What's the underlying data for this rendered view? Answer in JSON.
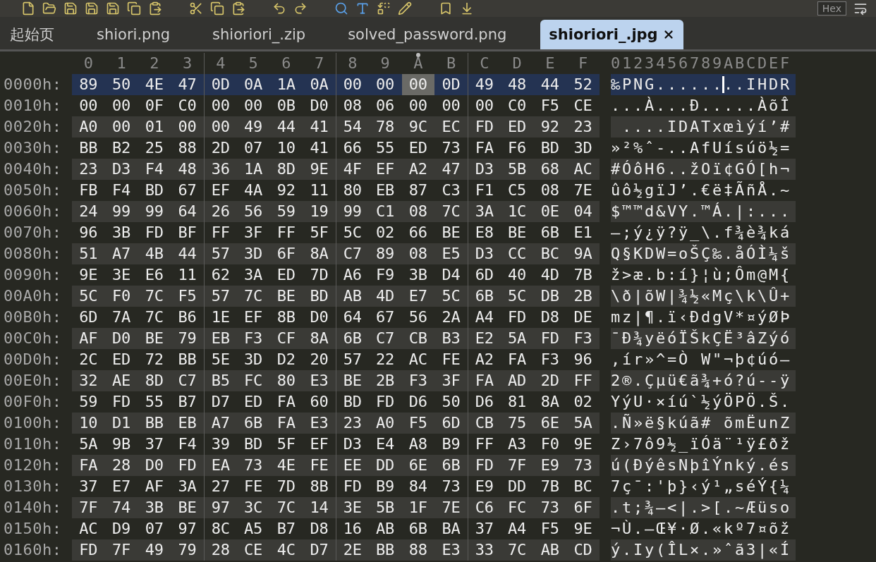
{
  "toolbar": {
    "label": "Hex"
  },
  "tabs": [
    {
      "label": "起始页",
      "selected": false
    },
    {
      "label": "shiori.png",
      "selected": false
    },
    {
      "label": "shioriori_.zip",
      "selected": false
    },
    {
      "label": "solved_password.png",
      "selected": false
    },
    {
      "label": "shioriori_.jpg",
      "selected": true
    }
  ],
  "hex_view": {
    "columns": [
      {
        "label": "0",
        "selected": false
      },
      {
        "label": "1",
        "selected": false
      },
      {
        "label": "2",
        "selected": false
      },
      {
        "label": "3",
        "selected": false
      },
      {
        "label": "4",
        "selected": false
      },
      {
        "label": "5",
        "selected": false
      },
      {
        "label": "6",
        "selected": false
      },
      {
        "label": "7",
        "selected": false
      },
      {
        "label": "8",
        "selected": false
      },
      {
        "label": "9",
        "selected": false
      },
      {
        "label": "A",
        "selected": true
      },
      {
        "label": "B",
        "selected": false
      },
      {
        "label": "C",
        "selected": false
      },
      {
        "label": "D",
        "selected": false
      },
      {
        "label": "E",
        "selected": false
      },
      {
        "label": "F",
        "selected": false
      }
    ],
    "ascii_header": "0123456789ABCDEF",
    "rows": [
      {
        "address": "0000h:",
        "selected": true,
        "bytes": [
          "89",
          "50",
          "4E",
          "47",
          "0D",
          "0A",
          "1A",
          "0A",
          "00",
          "00",
          "00",
          "0D",
          "49",
          "48",
          "44",
          "52"
        ],
        "ascii": "‰PNG........IHDR"
      },
      {
        "address": "0010h:",
        "selected": false,
        "bytes": [
          "00",
          "00",
          "0F",
          "C0",
          "00",
          "00",
          "0B",
          "D0",
          "08",
          "06",
          "00",
          "00",
          "00",
          "C0",
          "F5",
          "CE"
        ],
        "ascii": "...À...Ð.....ÀõÎ"
      },
      {
        "address": "0020h:",
        "selected": false,
        "bytes": [
          "A0",
          "00",
          "01",
          "00",
          "00",
          "49",
          "44",
          "41",
          "54",
          "78",
          "9C",
          "EC",
          "FD",
          "ED",
          "92",
          "23"
        ],
        "ascii": " ....IDATxœìýí’#"
      },
      {
        "address": "0030h:",
        "selected": false,
        "bytes": [
          "BB",
          "B2",
          "25",
          "88",
          "2D",
          "07",
          "10",
          "41",
          "66",
          "55",
          "ED",
          "73",
          "FA",
          "F6",
          "BD",
          "3D"
        ],
        "ascii": "»²%ˆ-..AfUísúö½="
      },
      {
        "address": "0040h:",
        "selected": false,
        "bytes": [
          "23",
          "D3",
          "F4",
          "48",
          "36",
          "1A",
          "8D",
          "9E",
          "4F",
          "EF",
          "A2",
          "47",
          "D3",
          "5B",
          "68",
          "AC"
        ],
        "ascii": "#ÓôH6..žOï¢GÓ[h¬"
      },
      {
        "address": "0050h:",
        "selected": false,
        "bytes": [
          "FB",
          "F4",
          "BD",
          "67",
          "EF",
          "4A",
          "92",
          "11",
          "80",
          "EB",
          "87",
          "C3",
          "F1",
          "C5",
          "08",
          "7E"
        ],
        "ascii": "ûô½gïJ’.€ë‡ÃñÅ.~"
      },
      {
        "address": "0060h:",
        "selected": false,
        "bytes": [
          "24",
          "99",
          "99",
          "64",
          "26",
          "56",
          "59",
          "19",
          "99",
          "C1",
          "08",
          "7C",
          "3A",
          "1C",
          "0E",
          "04"
        ],
        "ascii": "$™™d&VY.™Á.|:..."
      },
      {
        "address": "0070h:",
        "selected": false,
        "bytes": [
          "96",
          "3B",
          "FD",
          "BF",
          "FF",
          "3F",
          "FF",
          "5F",
          "5C",
          "02",
          "66",
          "BE",
          "E8",
          "BE",
          "6B",
          "E1"
        ],
        "ascii": "–;ý¿ÿ?ÿ_\\.f¾è¾ká"
      },
      {
        "address": "0080h:",
        "selected": false,
        "bytes": [
          "51",
          "A7",
          "4B",
          "44",
          "57",
          "3D",
          "6F",
          "8A",
          "C7",
          "89",
          "08",
          "E5",
          "D3",
          "CC",
          "BC",
          "9A"
        ],
        "ascii": "Q§KDW=oŠÇ‰.åÓÌ¼š"
      },
      {
        "address": "0090h:",
        "selected": false,
        "bytes": [
          "9E",
          "3E",
          "E6",
          "11",
          "62",
          "3A",
          "ED",
          "7D",
          "A6",
          "F9",
          "3B",
          "D4",
          "6D",
          "40",
          "4D",
          "7B"
        ],
        "ascii": "ž>æ.b:í}¦ù;Ôm@M{"
      },
      {
        "address": "00A0h:",
        "selected": false,
        "bytes": [
          "5C",
          "F0",
          "7C",
          "F5",
          "57",
          "7C",
          "BE",
          "BD",
          "AB",
          "4D",
          "E7",
          "5C",
          "6B",
          "5C",
          "DB",
          "2B"
        ],
        "ascii": "\\ð|õW|¾½«Mç\\k\\Û+"
      },
      {
        "address": "00B0h:",
        "selected": false,
        "bytes": [
          "6D",
          "7A",
          "7C",
          "B6",
          "1E",
          "EF",
          "8B",
          "D0",
          "64",
          "67",
          "56",
          "2A",
          "A4",
          "FD",
          "D8",
          "DE"
        ],
        "ascii": "mz|¶.ï‹ÐdgV*¤ýØÞ"
      },
      {
        "address": "00C0h:",
        "selected": false,
        "bytes": [
          "AF",
          "D0",
          "BE",
          "79",
          "EB",
          "F3",
          "CF",
          "8A",
          "6B",
          "C7",
          "CB",
          "B3",
          "E2",
          "5A",
          "FD",
          "F3"
        ],
        "ascii": "¯Ð¾yëóÏŠkÇË³âZýó"
      },
      {
        "address": "00D0h:",
        "selected": false,
        "bytes": [
          "2C",
          "ED",
          "72",
          "BB",
          "5E",
          "3D",
          "D2",
          "20",
          "57",
          "22",
          "AC",
          "FE",
          "A2",
          "FA",
          "F3",
          "96"
        ],
        "ascii": ",ír»^=Ò W\"¬þ¢úó–"
      },
      {
        "address": "00E0h:",
        "selected": false,
        "bytes": [
          "32",
          "AE",
          "8D",
          "C7",
          "B5",
          "FC",
          "80",
          "E3",
          "BE",
          "2B",
          "F3",
          "3F",
          "FA",
          "AD",
          "2D",
          "FF"
        ],
        "ascii": "2®.Çµü€ã¾+ó?ú--ÿ"
      },
      {
        "address": "00F0h:",
        "selected": false,
        "bytes": [
          "59",
          "FD",
          "55",
          "B7",
          "D7",
          "ED",
          "FA",
          "60",
          "BD",
          "FD",
          "D6",
          "50",
          "D6",
          "81",
          "8A",
          "02"
        ],
        "ascii": "YýU·×íú`½ýÖPÖ.Š."
      },
      {
        "address": "0100h:",
        "selected": false,
        "bytes": [
          "10",
          "D1",
          "BB",
          "EB",
          "A7",
          "6B",
          "FA",
          "E3",
          "23",
          "A0",
          "F5",
          "6D",
          "CB",
          "75",
          "6E",
          "5A"
        ],
        "ascii": ".Ñ»ë§kúã# õmËunZ"
      },
      {
        "address": "0110h:",
        "selected": false,
        "bytes": [
          "5A",
          "9B",
          "37",
          "F4",
          "39",
          "BD",
          "5F",
          "EF",
          "D3",
          "E4",
          "A8",
          "B9",
          "FF",
          "A3",
          "F0",
          "9E"
        ],
        "ascii": "Z›7ô9½_ïÓä¨¹ÿ£ðž"
      },
      {
        "address": "0120h:",
        "selected": false,
        "bytes": [
          "FA",
          "28",
          "D0",
          "FD",
          "EA",
          "73",
          "4E",
          "FE",
          "EE",
          "DD",
          "6E",
          "6B",
          "FD",
          "7F",
          "E9",
          "73"
        ],
        "ascii": "ú(ÐýêsNþîÝnký.és"
      },
      {
        "address": "0130h:",
        "selected": false,
        "bytes": [
          "37",
          "E7",
          "AF",
          "3A",
          "27",
          "FE",
          "7D",
          "8B",
          "FD",
          "B9",
          "84",
          "73",
          "E9",
          "DD",
          "7B",
          "BC"
        ],
        "ascii": "7ç¯:'þ}‹ý¹„séÝ{¼"
      },
      {
        "address": "0140h:",
        "selected": false,
        "bytes": [
          "7F",
          "74",
          "3B",
          "BE",
          "97",
          "3C",
          "7C",
          "14",
          "3E",
          "5B",
          "1F",
          "7E",
          "C6",
          "FC",
          "73",
          "6F"
        ],
        "ascii": ".t;¾—<|.>[.~Æüso"
      },
      {
        "address": "0150h:",
        "selected": false,
        "bytes": [
          "AC",
          "D9",
          "07",
          "97",
          "8C",
          "A5",
          "B7",
          "D8",
          "16",
          "AB",
          "6B",
          "BA",
          "37",
          "A4",
          "F5",
          "9E"
        ],
        "ascii": "¬Ù.—Œ¥·Ø.«kº7¤õž"
      },
      {
        "address": "0160h:",
        "selected": false,
        "bytes": [
          "FD",
          "7F",
          "49",
          "79",
          "28",
          "CE",
          "4C",
          "D7",
          "2E",
          "BB",
          "88",
          "E3",
          "33",
          "7C",
          "AB",
          "CD"
        ],
        "ascii": "ý.Iy(ÎL×.»ˆã3|«Í"
      }
    ]
  }
}
